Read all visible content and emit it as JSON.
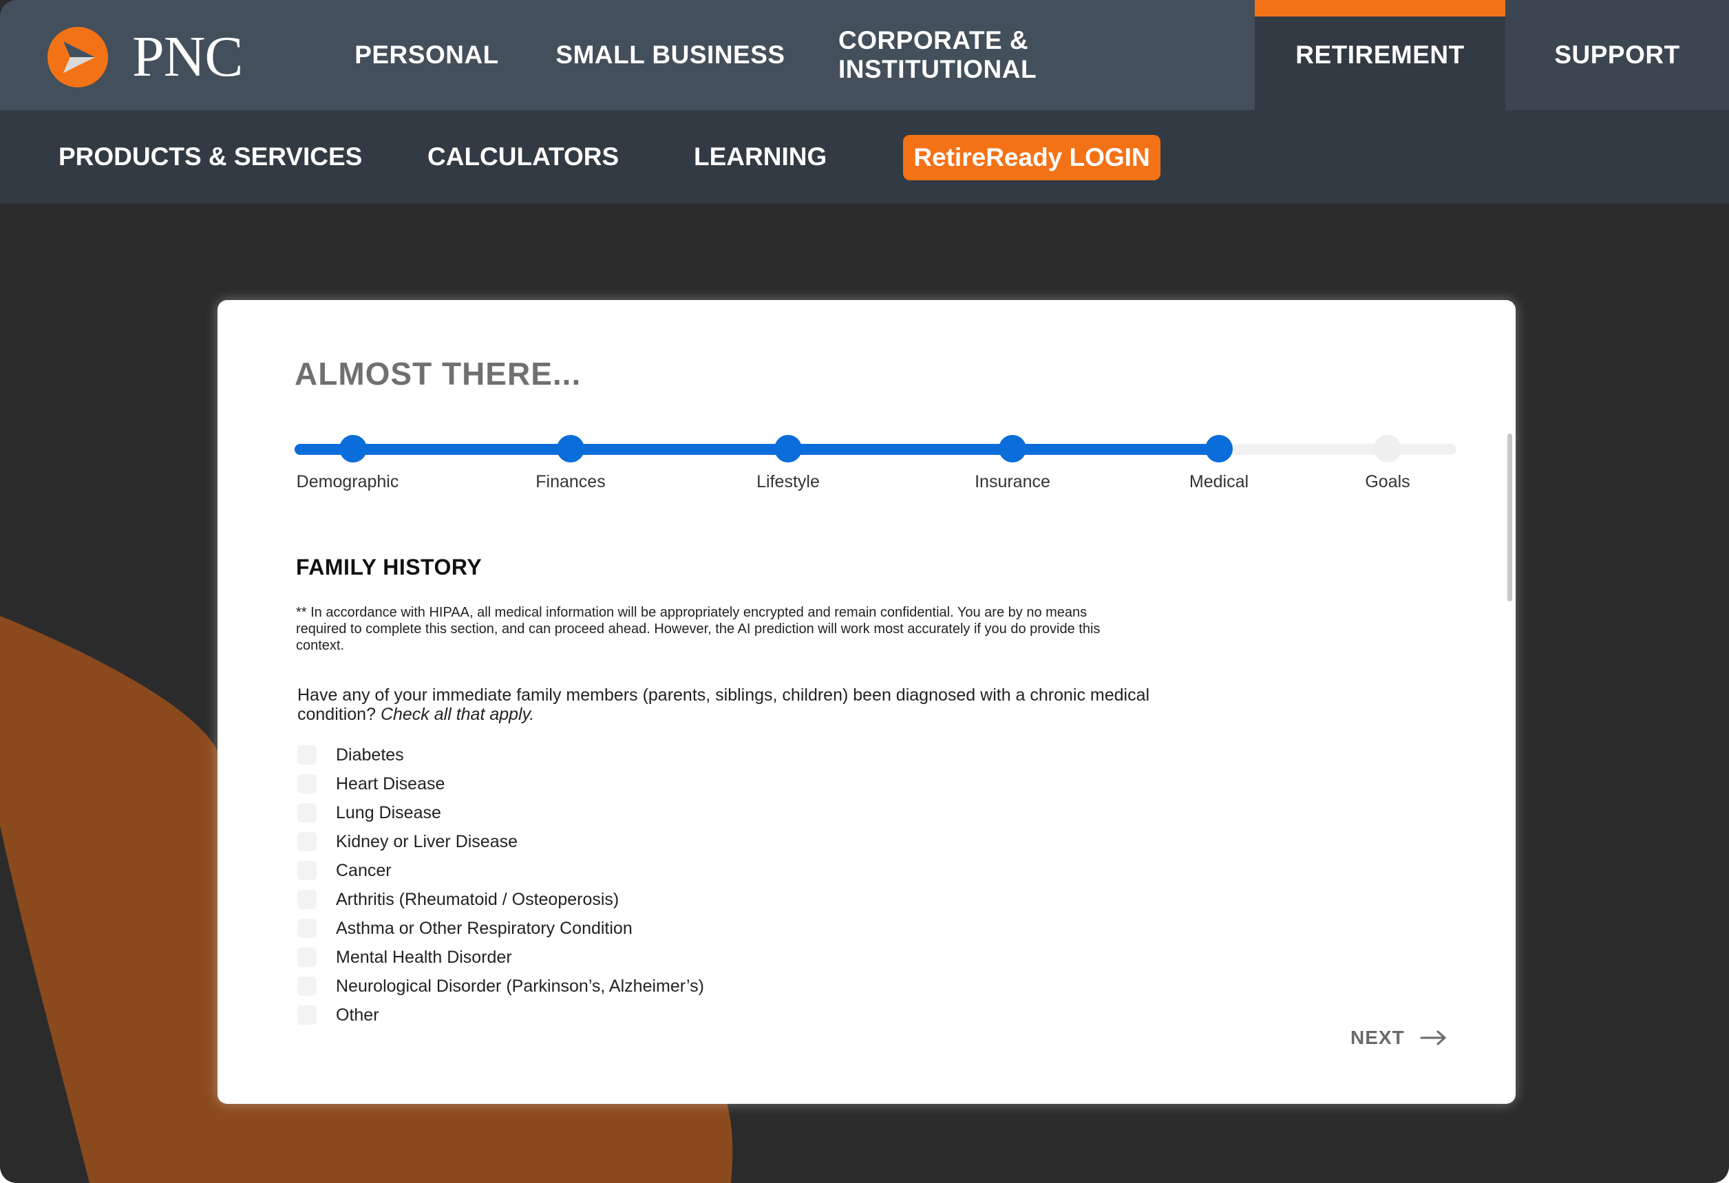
{
  "brand": {
    "name": "PNC",
    "accent": "#f47216",
    "progress_color": "#0a6dd9"
  },
  "topnav": {
    "items": [
      {
        "label": "PERSONAL"
      },
      {
        "label": "SMALL BUSINESS"
      },
      {
        "label": "CORPORATE & INSTITUTIONAL"
      },
      {
        "label": "RETIREMENT",
        "active": true
      },
      {
        "label": "SUPPORT"
      }
    ]
  },
  "subnav": {
    "items": [
      {
        "label": "PRODUCTS & SERVICES"
      },
      {
        "label": "CALCULATORS"
      },
      {
        "label": "LEARNING"
      }
    ],
    "login_label": "RetireReady LOGIN"
  },
  "form": {
    "title": "ALMOST THERE...",
    "progress": {
      "steps": [
        "Demographic",
        "Finances",
        "Lifestyle",
        "Insurance",
        "Medical",
        "Goals"
      ],
      "completed_steps": 5
    },
    "section_title": "FAMILY HISTORY",
    "notice": "** In accordance with HIPAA, all medical information will be appropriately encrypted and remain confidential. You are by no means required to complete this section, and can proceed ahead. However, the AI prediction will work most accurately if you do provide this context.",
    "question": "Have any of your immediate family members (parents, siblings, children) been diagnosed with a chronic medical condition?",
    "question_hint": "Check all that apply.",
    "options": [
      "Diabetes",
      "Heart Disease",
      "Lung Disease",
      "Kidney or Liver Disease",
      "Cancer",
      "Arthritis (Rheumatoid / Osteoperosis)",
      "Asthma or Other Respiratory Condition",
      "Mental Health Disorder",
      "Neurological Disorder (Parkinson’s, Alzheimer’s)",
      "Other"
    ],
    "next_label": "NEXT"
  }
}
